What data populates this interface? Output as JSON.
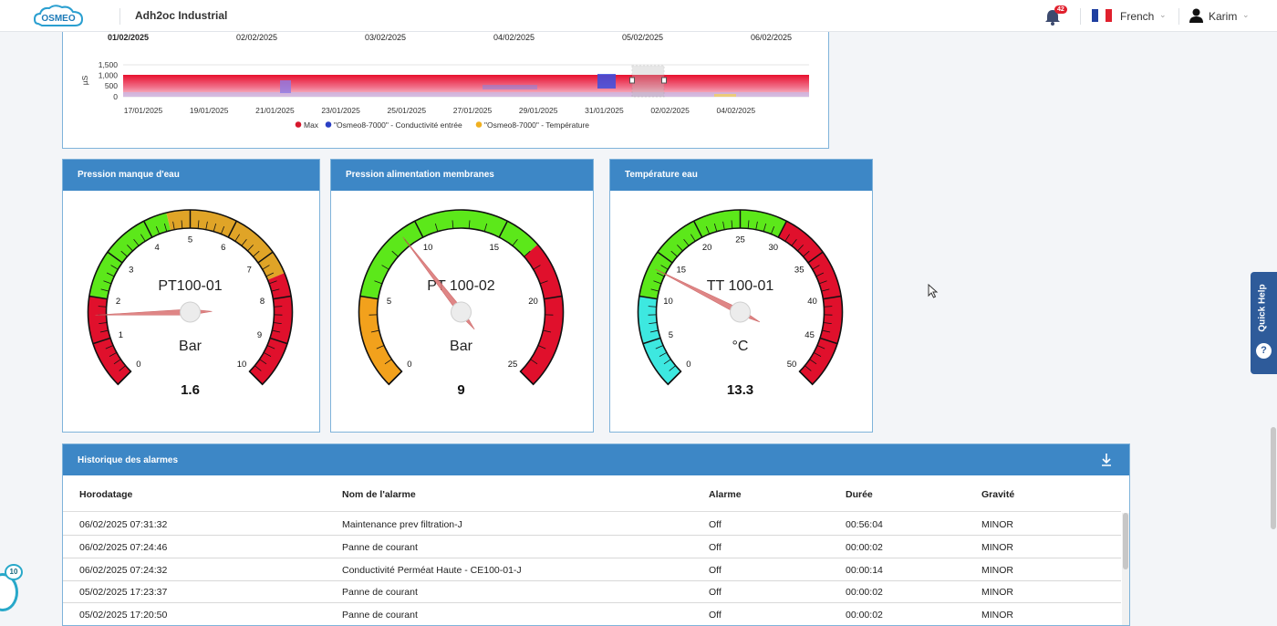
{
  "header": {
    "logo_text": "OSMEO",
    "site_name": "Adh2oc Industrial",
    "notifications_count": "42",
    "language": "French",
    "user": "Karim"
  },
  "trend_chart": {
    "top_dates": [
      "01/02/2025",
      "02/02/2025",
      "03/02/2025",
      "04/02/2025",
      "05/02/2025",
      "06/02/2025"
    ],
    "y_unit": "µS",
    "y_ticks": [
      "1,500",
      "1,000",
      "500",
      "0"
    ],
    "x_ticks": [
      "17/01/2025",
      "19/01/2025",
      "21/01/2025",
      "23/01/2025",
      "25/01/2025",
      "27/01/2025",
      "29/01/2025",
      "31/01/2025",
      "02/02/2025",
      "04/02/2025"
    ],
    "legend": [
      {
        "label": "Max",
        "color": "#d6172c"
      },
      {
        "label": "\"Osmeo8-7000\" - Conductivité entrée",
        "color": "#2a3fc4"
      },
      {
        "label": "\"Osmeo8-7000\" - Température",
        "color": "#f0b020"
      }
    ]
  },
  "gauges": [
    {
      "title": "Pression manque d'eau",
      "name": "PT100-01",
      "unit": "Bar",
      "value": "1.6",
      "value_num": 1.6,
      "min": 0,
      "max": 10,
      "ticks": [
        "0",
        "1",
        "2",
        "3",
        "4",
        "5",
        "6",
        "7",
        "8",
        "9",
        "10"
      ],
      "bands": [
        {
          "from": 0,
          "to": 2,
          "color": "#e0102c"
        },
        {
          "from": 2,
          "to": 4.5,
          "color": "#5ce81a"
        },
        {
          "from": 4.5,
          "to": 7.5,
          "color": "#e0a427"
        },
        {
          "from": 7.5,
          "to": 10,
          "color": "#e0102c"
        }
      ]
    },
    {
      "title": "Pression alimentation membranes",
      "name": "PT 100-02",
      "unit": "Bar",
      "value": "9",
      "value_num": 9,
      "min": 0,
      "max": 25,
      "ticks": [
        "0",
        "5",
        "10",
        "15",
        "20",
        "25"
      ],
      "bands": [
        {
          "from": 0,
          "to": 5,
          "color": "#f2a11c"
        },
        {
          "from": 5,
          "to": 17,
          "color": "#5ce81a"
        },
        {
          "from": 17,
          "to": 25,
          "color": "#e0102c"
        }
      ]
    },
    {
      "title": "Température eau",
      "name": "TT 100-01",
      "unit": "°C",
      "value": "13.3",
      "value_num": 13.3,
      "min": 0,
      "max": 50,
      "ticks": [
        "0",
        "5",
        "10",
        "15",
        "20",
        "25",
        "30",
        "35",
        "40",
        "45",
        "50"
      ],
      "bands": [
        {
          "from": 0,
          "to": 10,
          "color": "#3de8e0"
        },
        {
          "from": 10,
          "to": 30,
          "color": "#5ce81a"
        },
        {
          "from": 30,
          "to": 50,
          "color": "#e0102c"
        }
      ]
    }
  ],
  "quick_help": {
    "label": "Quick Help",
    "icon": "?"
  },
  "alarms": {
    "title": "Historique des alarmes",
    "columns": [
      "Horodatage",
      "Nom de l'alarme",
      "Alarme",
      "Durée",
      "Gravité"
    ],
    "rows": [
      [
        "06/02/2025 07:31:32",
        "Maintenance prev filtration-J",
        "Off",
        "00:56:04",
        "MINOR"
      ],
      [
        "06/02/2025 07:24:46",
        "Panne de courant",
        "Off",
        "00:00:02",
        "MINOR"
      ],
      [
        "06/02/2025 07:24:32",
        "Conductivité Perméat Haute - CE100-01-J",
        "Off",
        "00:00:14",
        "MINOR"
      ],
      [
        "05/02/2025 17:23:37",
        "Panne de courant",
        "Off",
        "00:00:02",
        "MINOR"
      ],
      [
        "05/02/2025 17:20:50",
        "Panne de courant",
        "Off",
        "00:00:02",
        "MINOR"
      ]
    ]
  },
  "floating_widget": {
    "count": "10"
  }
}
